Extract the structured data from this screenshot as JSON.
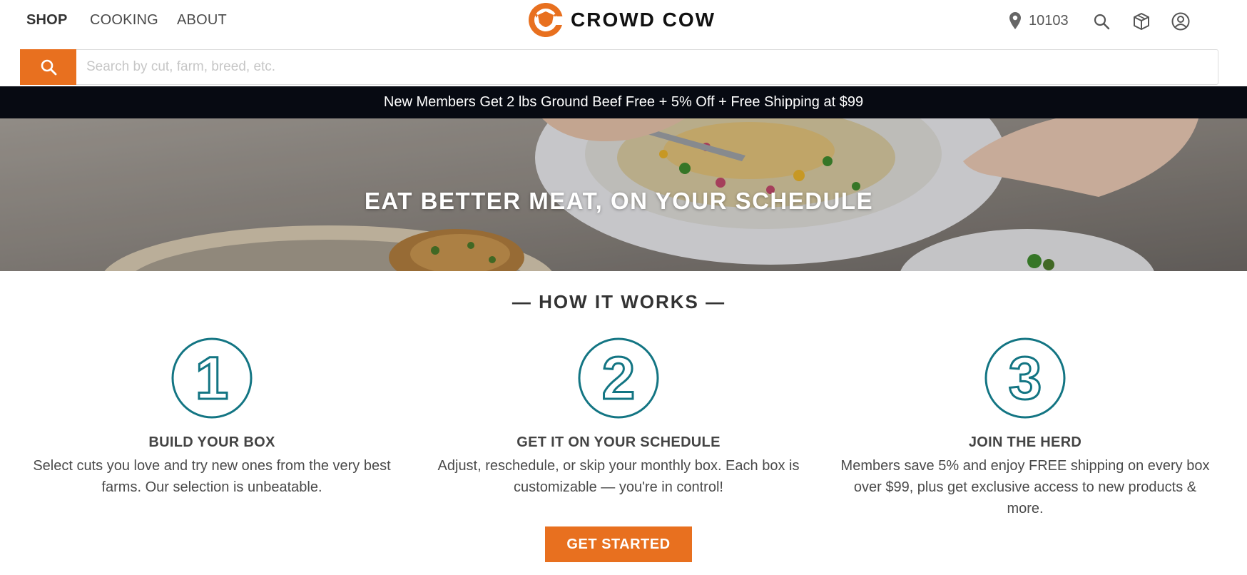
{
  "nav": {
    "items": [
      {
        "label": "SHOP"
      },
      {
        "label": "COOKING"
      },
      {
        "label": "ABOUT"
      }
    ]
  },
  "brand": {
    "name": "CROWD COW",
    "color": "#e8701f"
  },
  "header": {
    "zip_code": "10103",
    "icons": [
      "location-pin-icon",
      "search-icon",
      "box-icon",
      "account-icon"
    ]
  },
  "search": {
    "placeholder": "Search by cut, farm, breed, etc.",
    "value": ""
  },
  "promo": {
    "text": "New Members Get 2 lbs Ground Beef Free + 5% Off + Free Shipping at $99"
  },
  "hero": {
    "title": "EAT BETTER MEAT, ON YOUR SCHEDULE"
  },
  "how_it_works": {
    "title": "— HOW IT WORKS —",
    "accent_color": "#137583",
    "steps": [
      {
        "number": "1",
        "title": "BUILD YOUR BOX",
        "description": "Select cuts you love and try new ones from the very best farms. Our selection is unbeatable."
      },
      {
        "number": "2",
        "title": "GET IT ON YOUR SCHEDULE",
        "description": "Adjust, reschedule, or skip your monthly box. Each box is customizable — you're in control!"
      },
      {
        "number": "3",
        "title": "JOIN THE HERD",
        "description": "Members save 5% and enjoy FREE shipping on every box over $99, plus get exclusive access to new products & more."
      }
    ]
  },
  "cta": {
    "label": "GET STARTED"
  }
}
